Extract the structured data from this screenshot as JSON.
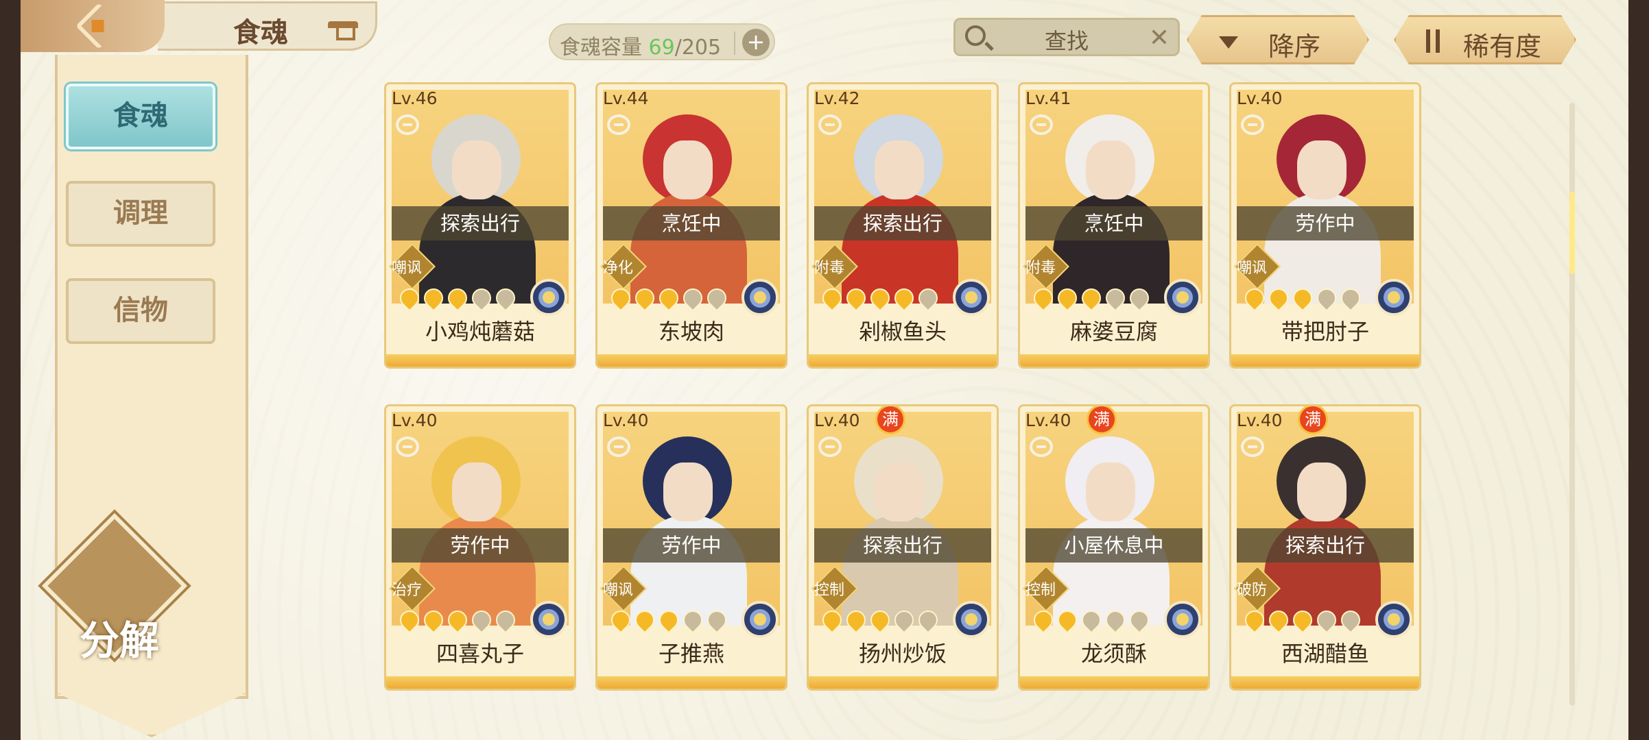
{
  "header": {
    "title": "食魂",
    "capacity_label": "食魂容量",
    "capacity_current": "69",
    "capacity_max": "/205",
    "search_placeholder": "查找",
    "sort_order": "降序",
    "sort_by": "稀有度"
  },
  "sidebar": {
    "tabs": [
      "食魂",
      "调理",
      "信物"
    ],
    "decompose": "分解"
  },
  "cards": [
    {
      "level": "Lv.46",
      "status": "探索出行",
      "trait": "嘲讽",
      "name": "小鸡炖蘑菇",
      "stars": 3,
      "full": false,
      "hair": "#d9d6ce",
      "robe": "#2c2a2c"
    },
    {
      "level": "Lv.44",
      "status": "烹饪中",
      "trait": "净化",
      "name": "东坡肉",
      "stars": 3,
      "full": false,
      "hair": "#c93331",
      "robe": "#d5643a"
    },
    {
      "level": "Lv.42",
      "status": "探索出行",
      "trait": "附毒",
      "name": "剁椒鱼头",
      "stars": 4,
      "full": false,
      "hair": "#cfd8e3",
      "robe": "#c83526"
    },
    {
      "level": "Lv.41",
      "status": "烹饪中",
      "trait": "附毒",
      "name": "麻婆豆腐",
      "stars": 3,
      "full": false,
      "hair": "#f1ede8",
      "robe": "#2e2628"
    },
    {
      "level": "Lv.40",
      "status": "劳作中",
      "trait": "嘲讽",
      "name": "带把肘子",
      "stars": 3,
      "full": false,
      "hair": "#a52637",
      "robe": "#f0ebe5"
    },
    {
      "level": "Lv.40",
      "status": "劳作中",
      "trait": "治疗",
      "name": "四喜丸子",
      "stars": 3,
      "full": false,
      "hair": "#f0c34e",
      "robe": "#e88a4b"
    },
    {
      "level": "Lv.40",
      "status": "劳作中",
      "trait": "嘲讽",
      "name": "子推燕",
      "stars": 3,
      "full": false,
      "hair": "#27305a",
      "robe": "#eef0f2"
    },
    {
      "level": "Lv.40",
      "status": "探索出行",
      "trait": "控制",
      "name": "扬州炒饭",
      "stars": 3,
      "full": true,
      "hair": "#eadfc9",
      "robe": "#d9c9ae"
    },
    {
      "level": "Lv.40",
      "status": "小屋休息中",
      "trait": "控制",
      "name": "龙须酥",
      "stars": 2,
      "full": true,
      "hair": "#f0eef2",
      "robe": "#f3f0ef"
    },
    {
      "level": "Lv.40",
      "status": "探索出行",
      "trait": "破防",
      "name": "西湖醋鱼",
      "stars": 3,
      "full": true,
      "hair": "#3a3030",
      "robe": "#b03a2c"
    }
  ]
}
